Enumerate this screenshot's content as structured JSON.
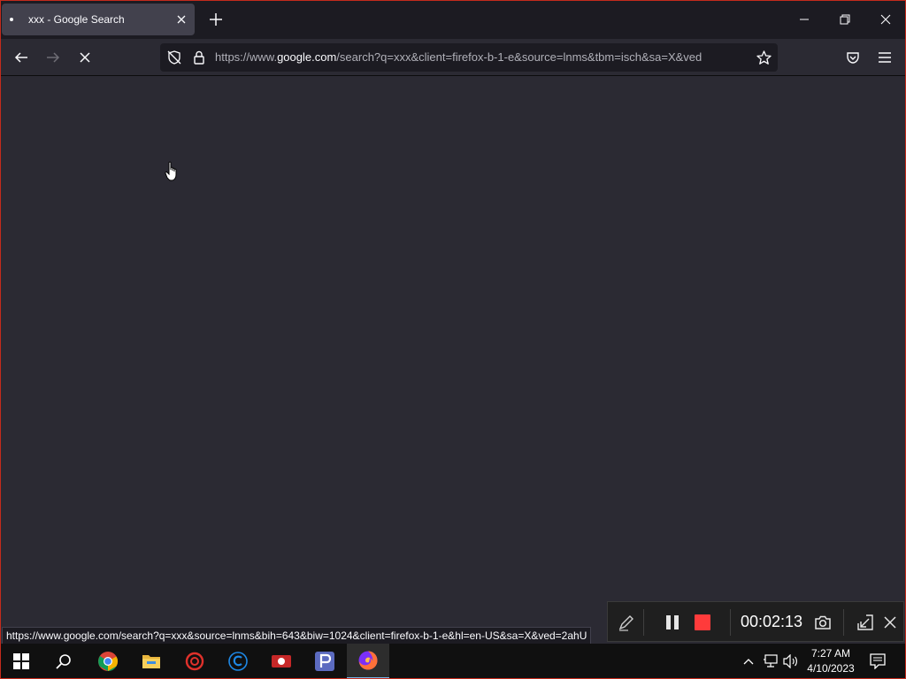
{
  "browser": {
    "tab": {
      "title": "xxx - Google Search"
    },
    "url": {
      "prefix": "https://www.",
      "domain": "google.com",
      "path": "/search?q=xxx&client=firefox-b-1-e&source=lnms&tbm=isch&sa=X&ved"
    },
    "status_url": "https://www.google.com/search?q=xxx&source=lnms&bih=643&biw=1024&client=firefox-b-1-e&hl=en-US&sa=X&ved=2ahU"
  },
  "recorder": {
    "timer": "00:02:13",
    "accent_color": "#ff3b3b"
  },
  "taskbar": {
    "apps": [
      "start-icon",
      "search-icon",
      "chrome-icon",
      "file-explorer-icon",
      "app-red-icon",
      "app-c-icon",
      "screen-recorder-icon",
      "app-p-icon",
      "firefox-icon"
    ],
    "clock": {
      "time": "7:27 AM",
      "date": "4/10/2023"
    }
  },
  "colors": {
    "page_bg": "#2b2a33",
    "tab_bg": "#42414d",
    "titlebar_bg": "#1c1b22",
    "taskbar_bg": "#101010"
  }
}
